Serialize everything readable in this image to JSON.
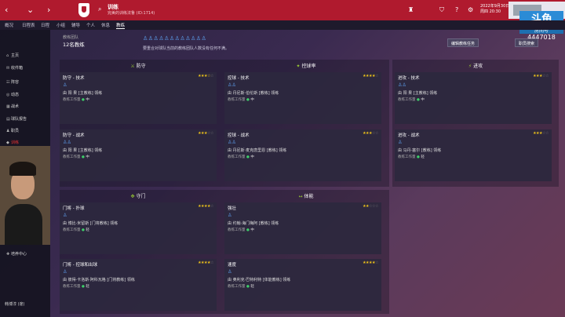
{
  "topbar": {
    "back_arrow": "‹",
    "forward_arrow": "›",
    "dropdown": "⌄",
    "title": "训练",
    "subtitle": "完美的训练法鲁 (ID:1714)",
    "date_line1": "2022年9月30日",
    "date_line2": "周四 20:30"
  },
  "tabs": [
    {
      "label": "概况"
    },
    {
      "label": "日程表"
    },
    {
      "label": "日程"
    },
    {
      "label": "小组"
    },
    {
      "label": "辅导"
    },
    {
      "label": "个人"
    },
    {
      "label": "休息"
    },
    {
      "label": "教练"
    }
  ],
  "watermark": {
    "big": "斗鱼",
    "mid": "房间号",
    "num": "4447018"
  },
  "sidebar": {
    "items": [
      {
        "label": "主页",
        "icon": "home-icon"
      },
      {
        "label": "收件箱",
        "icon": "inbox-icon"
      },
      {
        "label": "阵容",
        "icon": "squad-icon"
      },
      {
        "label": "动态",
        "icon": "dynamics-icon"
      },
      {
        "label": "战术",
        "icon": "tactics-icon"
      },
      {
        "label": "球队报告",
        "icon": "report-icon"
      },
      {
        "label": "职员",
        "icon": "staff-icon"
      },
      {
        "label": "训练",
        "icon": "training-icon"
      },
      {
        "label": "财政",
        "icon": "finance-icon"
      },
      {
        "label": "培养中心",
        "icon": "academy-icon"
      }
    ],
    "player_name": "韩博淳 (邃)"
  },
  "header": {
    "label": "教练团队",
    "count": "12名教练",
    "hint": "要重合对球队当前的教练团队人数没有任何不满。",
    "edit_button": "编辑教练任务",
    "search_button": "职员搜索"
  },
  "columns": [
    {
      "label": "防守",
      "icon": "defend-icon",
      "glyph": "⚔"
    },
    {
      "label": "控球率",
      "icon": "possession-icon",
      "glyph": "✦"
    },
    {
      "label": "进攻",
      "icon": "attack-icon",
      "glyph": "⚡"
    },
    {
      "label": "守门",
      "icon": "goalkeeping-icon",
      "glyph": "✥"
    },
    {
      "label": "体能",
      "icon": "fitness-icon",
      "glyph": "↔"
    }
  ],
  "cards": [
    {
      "title": "防守 - 技术",
      "stars": "★★★☆",
      "empty": "☆",
      "figs": "♙",
      "coach": "由 阳 果 [主教练] 领练",
      "work_label": "教练工作量",
      "work_value": "中"
    },
    {
      "title": "控球 - 技术",
      "stars": "★★★★",
      "empty": "☆",
      "figs": "♙♙",
      "coach": "由 丹尼斯·伯伦斯 [教练] 领练",
      "work_label": "教练工作量",
      "work_value": "中"
    },
    {
      "title": "进攻 - 技术",
      "stars": "★★★",
      "empty": "☆☆",
      "figs": "♙♙",
      "coach": "由 阳 果 [主教练] 领练",
      "work_label": "教练工作量",
      "work_value": "中"
    },
    {
      "title": "防守 - 战术",
      "stars": "★★★",
      "empty": "☆☆",
      "figs": "♙♙",
      "coach": "由 阳 果 [主教练] 领练",
      "work_label": "教练工作量",
      "work_value": "中"
    },
    {
      "title": "控球 - 战术",
      "stars": "★★★",
      "empty": "☆☆",
      "figs": "♙♙",
      "coach": "由 丹尼斯·麦克唐里恩 [教练] 领练",
      "work_label": "教练工作量",
      "work_value": "中"
    },
    {
      "title": "进攻 - 战术",
      "stars": "★★★",
      "empty": "☆☆",
      "figs": "♙",
      "coach": "由 马丹·塞尔 [教练] 领练",
      "work_label": "教练工作量",
      "work_value": "轻"
    },
    {
      "title": "门将 - 扑球",
      "stars": "★★★★",
      "empty": "☆",
      "figs": "♙",
      "coach": "由 博比·米留斯 [门将教练] 领练",
      "work_label": "教练工作量",
      "work_value": "轻"
    },
    {
      "title": "强壮",
      "stars": "★★",
      "empty": "☆☆☆",
      "figs": "♙",
      "coach": "由 约翰·海门梅阿 [教练] 领练",
      "work_label": "教练工作量",
      "work_value": "中"
    },
    {
      "title": "门将 - 控球和出球",
      "stars": "★★★★",
      "empty": "☆",
      "figs": "♙",
      "coach": "由 彼得·卡洛斯·阿科瓦格 [门将教练] 领练",
      "work_label": "教练工作量",
      "work_value": "轻"
    },
    {
      "title": "速度",
      "stars": "★★★★",
      "empty": "☆",
      "figs": "♙",
      "coach": "由 奥利克·巴特利特 [体能教练] 领练",
      "work_label": "教练工作量",
      "work_value": "轻"
    }
  ],
  "colors": {
    "topbar": "#b01a2e",
    "accent_blue": "#5b9be8",
    "star": "#f0c419",
    "workload_dot": "#3ecf6a"
  }
}
